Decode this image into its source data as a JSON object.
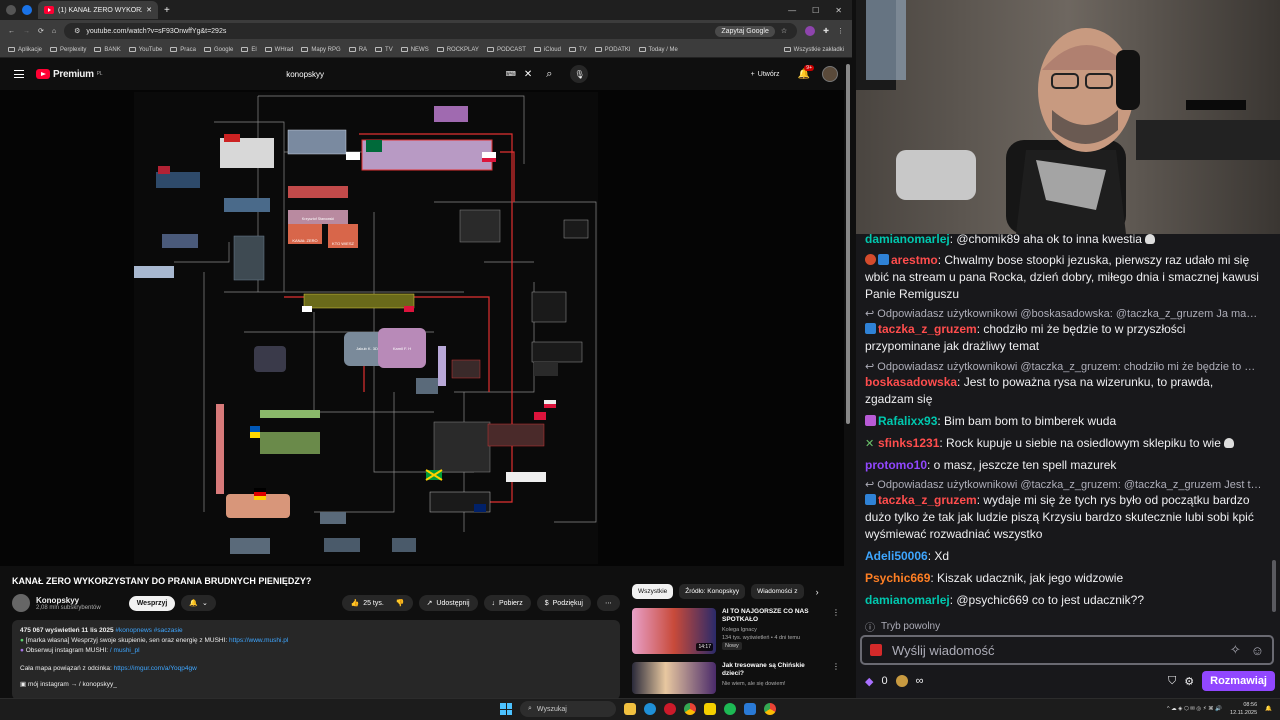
{
  "browser": {
    "tab_title": "(1) KANAŁ ZERO WYKORZY",
    "url": "youtube.com/watch?v=sF93OnwffYg&t=292s",
    "zapytaj": "Zapytaj Google",
    "bookmarks": [
      "Aplikacje",
      "Perplexity",
      "BANK",
      "YouTube",
      "Praca",
      "Google",
      "El",
      "WHrad",
      "Mapy RPG",
      "RA",
      "TV",
      "NEWS",
      "ROCKPLAY",
      "PODCAST",
      "iCloud",
      "TV",
      "PODATKI",
      "Today / Me"
    ],
    "all_bookmarks": "Wszystkie zakładki"
  },
  "youtube": {
    "logo": "Premium",
    "logo_sup": "PL",
    "search_value": "konopskyy",
    "create": "Utwórz",
    "notif_count": "9+",
    "video_title": "KANAŁ ZERO WYKORZYSTANY DO PRANIA BRUDNYCH PIENIĘDZY?",
    "channel": "Konopskyy",
    "subs": "2,08 mln subskrybentów",
    "support": "Wesprzyj",
    "likes": "25 tys.",
    "share": "Udostępnij",
    "download": "Pobierz",
    "thanks": "Podziękuj",
    "desc_line1_meta": "475 067 wyświetleń  11 lis 2025",
    "desc_line1_tags": "#konopnews #saczasie",
    "desc_line2": "[marka własna] Wesprzyj swoje skupienie, sen oraz energię z MUSHI:",
    "desc_line2_link": "https://www.mushi.pl",
    "desc_line3": "Obserwuj instagram MUSHI:",
    "desc_line3_link": "/ mushi_pl",
    "desc_line4": "Cała mapa powiązań z odcinka:",
    "desc_line4_link": "https://imgur.com/a/Yoqp4gw",
    "desc_line5": "mój instagram →",
    "desc_line5_link": "/ konopskyy_",
    "chips": [
      "Wszystkie",
      "Źródło: Konopskyy",
      "Wiadomości z"
    ],
    "recs": [
      {
        "title": "AI TO NAJGORSZE CO NAS SPOTKAŁO",
        "channel": "Kolega Ignacy",
        "meta": "134 tys. wyświetleń • 4 dni temu",
        "badge": "Nowy",
        "dur": "14:17"
      },
      {
        "title": "Jak tresowane są Chińskie dzieci?",
        "channel": "Nie wiem, ale się dowiem!",
        "meta": "",
        "badge": "",
        "dur": ""
      }
    ]
  },
  "diagram_labels": {
    "kanal_zero": "KANAŁ ZERO",
    "kto_wiesz": "KTO WIESZ",
    "jakub": "Jakub K. 3D",
    "kamil": "Kamil F. H",
    "krzysztof": "Krzysztof Stanowski",
    "krypto": "KRYPTO"
  },
  "chat": {
    "messages": [
      {
        "user": "damianomarlej",
        "color": "#00c8af",
        "text": ": @chomik89 aha ok to inna kwestia",
        "badge": ""
      },
      {
        "user": "arestmo",
        "color": "#ff4d4d",
        "text": ": Chwalmy bose stoopki jezuska, pierwszy raz udało mi się wbić na stream u pana Rocka, dzień dobry, miłego dnia i smacznej kawusi Panie Remiguszu",
        "badge": "red"
      },
      {
        "reply": "Odpowiadasz użytkownikowi @boskasadowska: @taczka_z_gruzem Ja mam w..."
      },
      {
        "user": "taczka_z_gruzem",
        "color": "#ff4d4d",
        "text": ": chodziło mi że będzie to w przyszłości przypominane jak drażliwy temat",
        "badge": "sub"
      },
      {
        "reply": "Odpowiadasz użytkownikowi @taczka_z_gruzem: chodziło mi że będzie to w pr..."
      },
      {
        "user": "boskasadowska",
        "color": "#ff4d4d",
        "text": ": Jest to poważna rysa na wizerunku, to prawda, zgadzam się",
        "badge": ""
      },
      {
        "user": "Rafalixx93",
        "color": "#00c8af",
        "text": ": Bim bam bom to bimberek wuda",
        "badge": "pink"
      },
      {
        "user": "sfinks1231",
        "color": "#ff4d4d",
        "text": ": Rock kupuje u siebie na osiedlowym sklepiku to wie",
        "badge": "x"
      },
      {
        "user": "protomo10",
        "color": "#9147ff",
        "text": ": o masz, jeszcze ten spell mazurek",
        "badge": ""
      },
      {
        "reply": "Odpowiadasz użytkownikowi @taczka_z_gruzem: @taczka_z_gruzem Jest to po..."
      },
      {
        "user": "taczka_z_gruzem",
        "color": "#ff4d4d",
        "text": ": wydaje mi się że tych rys było od początku bardzo dużo tylko że tak jak ludzie piszą Krzysiu bardzo skutecznie lubi sobi kpić wyśmiewać rozwadniać wszystko",
        "badge": "sub"
      },
      {
        "user": "Adeli50006",
        "color": "#3ea6ff",
        "text": ": Xd",
        "badge": ""
      },
      {
        "user": "Psychic669",
        "color": "#ff7f24",
        "text": ": Kiszak udacznik, jak jego widzowie",
        "badge": ""
      },
      {
        "user": "damianomarlej",
        "color": "#00c8af",
        "text": ": @psychic669 co to jest udacznik??",
        "badge": ""
      }
    ],
    "slow_mode": "Tryb powolny",
    "placeholder": "Wyślij wiadomość",
    "points": "0",
    "send": "Rozmawiaj"
  },
  "taskbar": {
    "search": "Wyszukaj",
    "time": "08:56",
    "date": "12.11.2025"
  }
}
